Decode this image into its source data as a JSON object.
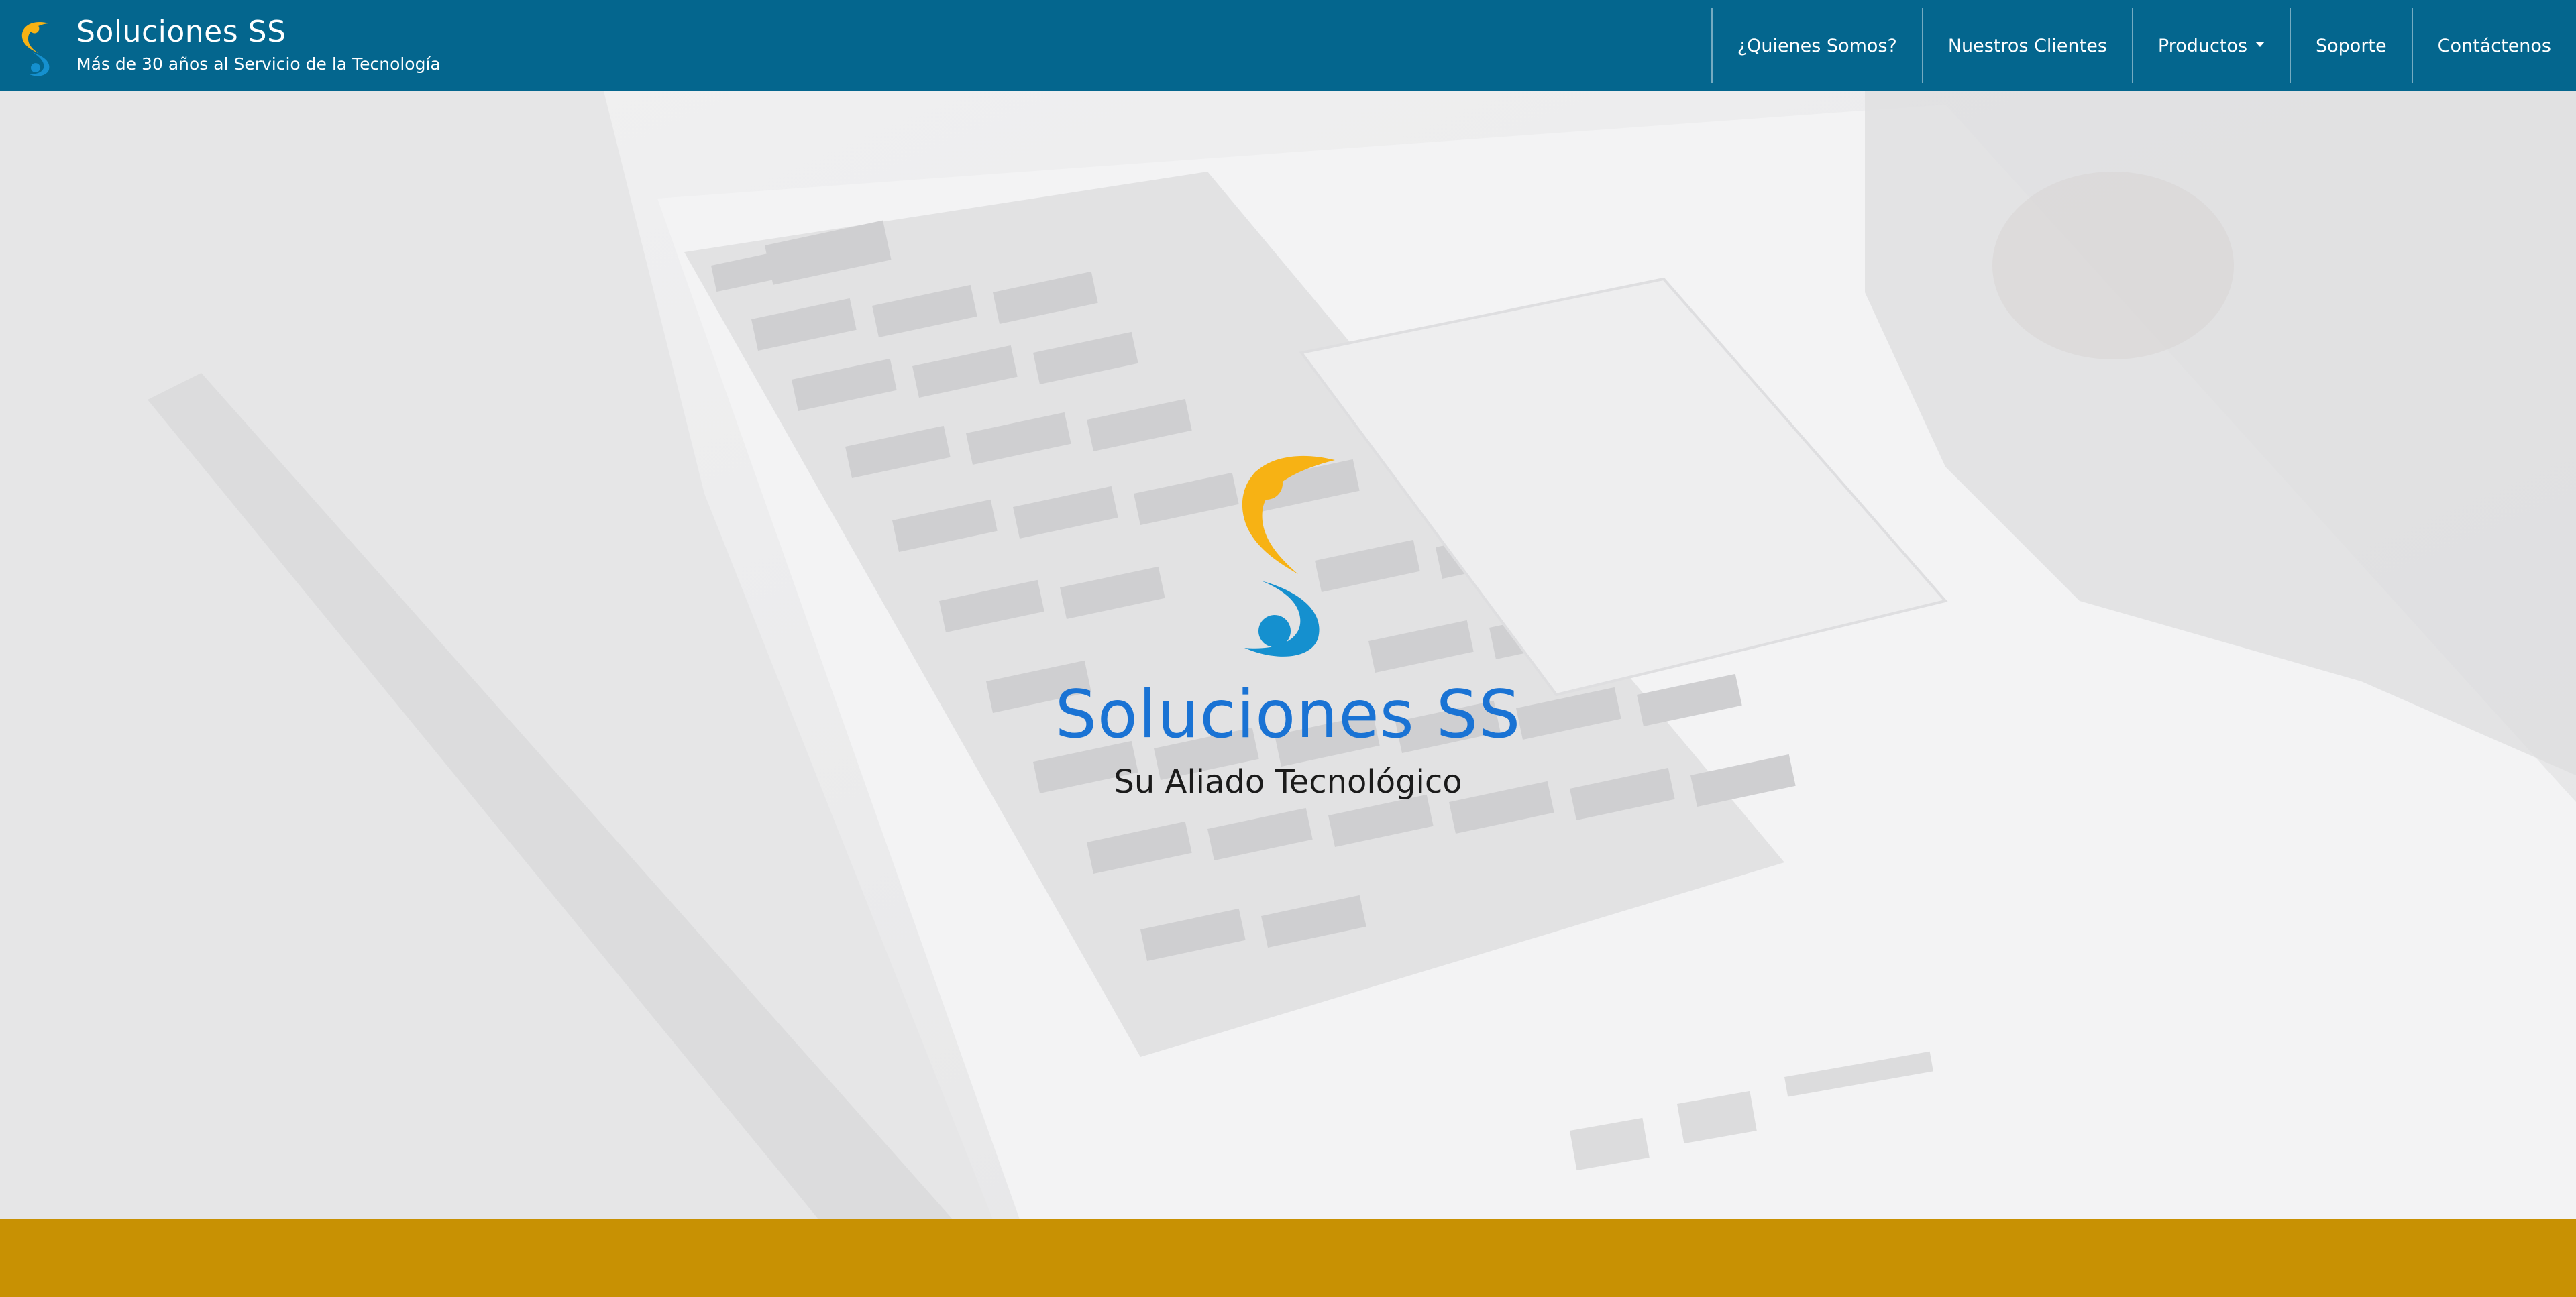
{
  "header": {
    "brand_title": "Soluciones SS",
    "brand_subtitle": "Más de 30 años al Servicio de la Tecnología",
    "logo_icon": "swirl-logo-icon"
  },
  "nav": {
    "items": [
      {
        "label": "¿Quienes Somos?"
      },
      {
        "label": "Nuestros Clientes"
      },
      {
        "label": "Productos",
        "has_dropdown": true
      },
      {
        "label": "Soporte"
      },
      {
        "label": "Contáctenos"
      }
    ]
  },
  "hero": {
    "title": "Soluciones SS",
    "tagline": "Su Aliado Tecnológico",
    "logo_icon": "swirl-logo-icon",
    "background": "laptop-keyboard-photo"
  },
  "colors": {
    "navbar": "#04668e",
    "accent_gold": "#c89103",
    "logo_orange": "#f7b214",
    "logo_blue": "#1590cf",
    "title_blue": "#1a73d4"
  }
}
